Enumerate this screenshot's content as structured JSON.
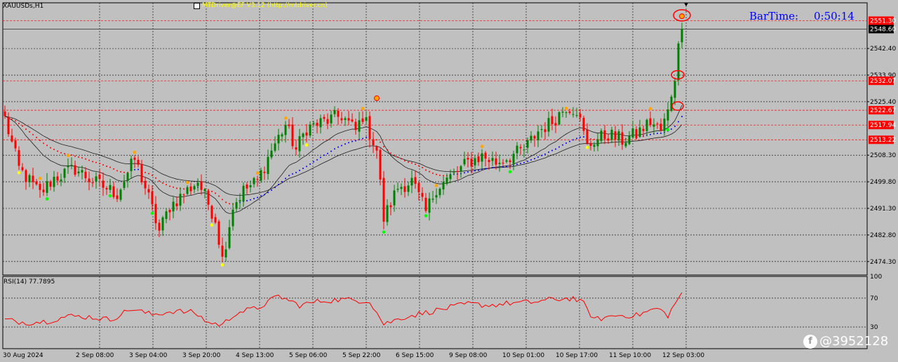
{
  "window": {
    "symbol": "XAUUSDs,H1"
  },
  "indicator": {
    "name": "MTDriver@EF  V3.12 (http://mtdriver.cn)"
  },
  "bartime": {
    "label": "BarTime:",
    "value": "0:50:14"
  },
  "rsi": {
    "label": "RSI(14) 77.7895"
  },
  "watermark": {
    "text": "@3952128",
    "icon": "app-logo-icon"
  },
  "colors": {
    "background": "#c0c0c0",
    "bull": "#008000",
    "bear": "#ff0000",
    "grid": "#000000",
    "level_line": "#ff0000",
    "rsi_line": "#ff0000",
    "trail_bear": "#ff0000",
    "trail_bull": "#0000ff",
    "current_price_tag": "#000000"
  },
  "chart_data": [
    {
      "type": "candlestick",
      "title": "",
      "y_ticks": [
        "2551.30",
        "2548.60",
        "2542.40",
        "2533.90",
        "2532.07",
        "2525.40",
        "2522.67",
        "2517.94",
        "2513.22",
        "2508.30",
        "2499.80",
        "2491.30",
        "2482.80",
        "2474.30"
      ],
      "tick_values": [
        2542.4,
        2533.9,
        2525.4,
        2508.3,
        2499.8,
        2491.3,
        2482.8,
        2474.3
      ],
      "level_lines": [
        2551.3,
        2532.07,
        2522.67,
        2517.94,
        2513.22
      ],
      "current_price": 2548.6,
      "x_labels": [
        "30 Aug 2024",
        "2 Sep 08:00",
        "3 Sep 04:00",
        "3 Sep 20:00",
        "4 Sep 13:00",
        "5 Sep 06:00",
        "5 Sep 22:00",
        "6 Sep 15:00",
        "9 Sep 08:00",
        "10 Sep 01:00",
        "10 Sep 17:00",
        "11 Sep 10:00",
        "12 Sep 03:00"
      ],
      "ylim": [
        2470.0,
        2557.0
      ],
      "anchors": [
        {
          "bar": 0,
          "price": 2520.0
        },
        {
          "bar": 4,
          "price": 2504.0
        },
        {
          "bar": 10,
          "price": 2496.0
        },
        {
          "bar": 14,
          "price": 2501.0
        },
        {
          "bar": 20,
          "price": 2504.0
        },
        {
          "bar": 25,
          "price": 2500.0
        },
        {
          "bar": 32,
          "price": 2496.0
        },
        {
          "bar": 37,
          "price": 2507.0
        },
        {
          "bar": 40,
          "price": 2498.0
        },
        {
          "bar": 44,
          "price": 2484.0
        },
        {
          "bar": 47,
          "price": 2492.0
        },
        {
          "bar": 52,
          "price": 2497.0
        },
        {
          "bar": 55,
          "price": 2500.0
        },
        {
          "bar": 60,
          "price": 2488.0
        },
        {
          "bar": 62,
          "price": 2475.0
        },
        {
          "bar": 65,
          "price": 2492.0
        },
        {
          "bar": 68,
          "price": 2497.0
        },
        {
          "bar": 72,
          "price": 2500.0
        },
        {
          "bar": 76,
          "price": 2510.0
        },
        {
          "bar": 80,
          "price": 2518.0
        },
        {
          "bar": 83,
          "price": 2510.0
        },
        {
          "bar": 86,
          "price": 2517.0
        },
        {
          "bar": 91,
          "price": 2519.0
        },
        {
          "bar": 96,
          "price": 2521.0
        },
        {
          "bar": 100,
          "price": 2516.0
        },
        {
          "bar": 102,
          "price": 2521.0
        },
        {
          "bar": 106,
          "price": 2510.0
        },
        {
          "bar": 108,
          "price": 2488.0
        },
        {
          "bar": 112,
          "price": 2498.0
        },
        {
          "bar": 116,
          "price": 2500.0
        },
        {
          "bar": 120,
          "price": 2490.0
        },
        {
          "bar": 123,
          "price": 2498.0
        },
        {
          "bar": 128,
          "price": 2502.0
        },
        {
          "bar": 132,
          "price": 2506.0
        },
        {
          "bar": 136,
          "price": 2508.0
        },
        {
          "bar": 140,
          "price": 2506.0
        },
        {
          "bar": 144,
          "price": 2508.0
        },
        {
          "bar": 148,
          "price": 2510.0
        },
        {
          "bar": 152,
          "price": 2516.0
        },
        {
          "bar": 156,
          "price": 2519.0
        },
        {
          "bar": 160,
          "price": 2524.0
        },
        {
          "bar": 163,
          "price": 2523.0
        },
        {
          "bar": 166,
          "price": 2511.0
        },
        {
          "bar": 168,
          "price": 2513.0
        },
        {
          "bar": 172,
          "price": 2515.0
        },
        {
          "bar": 176,
          "price": 2513.0
        },
        {
          "bar": 180,
          "price": 2515.0
        },
        {
          "bar": 184,
          "price": 2519.0
        },
        {
          "bar": 187,
          "price": 2516.0
        },
        {
          "bar": 189,
          "price": 2522.0
        },
        {
          "bar": 191,
          "price": 2532.0
        },
        {
          "bar": 192,
          "price": 2544.0
        },
        {
          "bar": 193,
          "price": 2548.6
        }
      ],
      "rsi": {
        "label": "RSI(14) 77.7895",
        "y_ticks": [
          "100",
          "70",
          "30"
        ],
        "levels": [
          70,
          30
        ],
        "ylim": [
          0,
          100
        ],
        "anchors": [
          {
            "bar": 0,
            "value": 40
          },
          {
            "bar": 6,
            "value": 36
          },
          {
            "bar": 12,
            "value": 38
          },
          {
            "bar": 18,
            "value": 45
          },
          {
            "bar": 24,
            "value": 44
          },
          {
            "bar": 30,
            "value": 40
          },
          {
            "bar": 36,
            "value": 55
          },
          {
            "bar": 42,
            "value": 47
          },
          {
            "bar": 48,
            "value": 52
          },
          {
            "bar": 54,
            "value": 50
          },
          {
            "bar": 58,
            "value": 36
          },
          {
            "bar": 62,
            "value": 33
          },
          {
            "bar": 66,
            "value": 50
          },
          {
            "bar": 72,
            "value": 56
          },
          {
            "bar": 78,
            "value": 73
          },
          {
            "bar": 84,
            "value": 60
          },
          {
            "bar": 90,
            "value": 66
          },
          {
            "bar": 96,
            "value": 68
          },
          {
            "bar": 104,
            "value": 66
          },
          {
            "bar": 108,
            "value": 34
          },
          {
            "bar": 114,
            "value": 44
          },
          {
            "bar": 120,
            "value": 50
          },
          {
            "bar": 126,
            "value": 56
          },
          {
            "bar": 132,
            "value": 62
          },
          {
            "bar": 138,
            "value": 60
          },
          {
            "bar": 144,
            "value": 63
          },
          {
            "bar": 150,
            "value": 64
          },
          {
            "bar": 156,
            "value": 68
          },
          {
            "bar": 162,
            "value": 70
          },
          {
            "bar": 165,
            "value": 62
          },
          {
            "bar": 168,
            "value": 40
          },
          {
            "bar": 174,
            "value": 46
          },
          {
            "bar": 180,
            "value": 46
          },
          {
            "bar": 186,
            "value": 56
          },
          {
            "bar": 189,
            "value": 46
          },
          {
            "bar": 193,
            "value": 77.79
          }
        ]
      }
    }
  ]
}
